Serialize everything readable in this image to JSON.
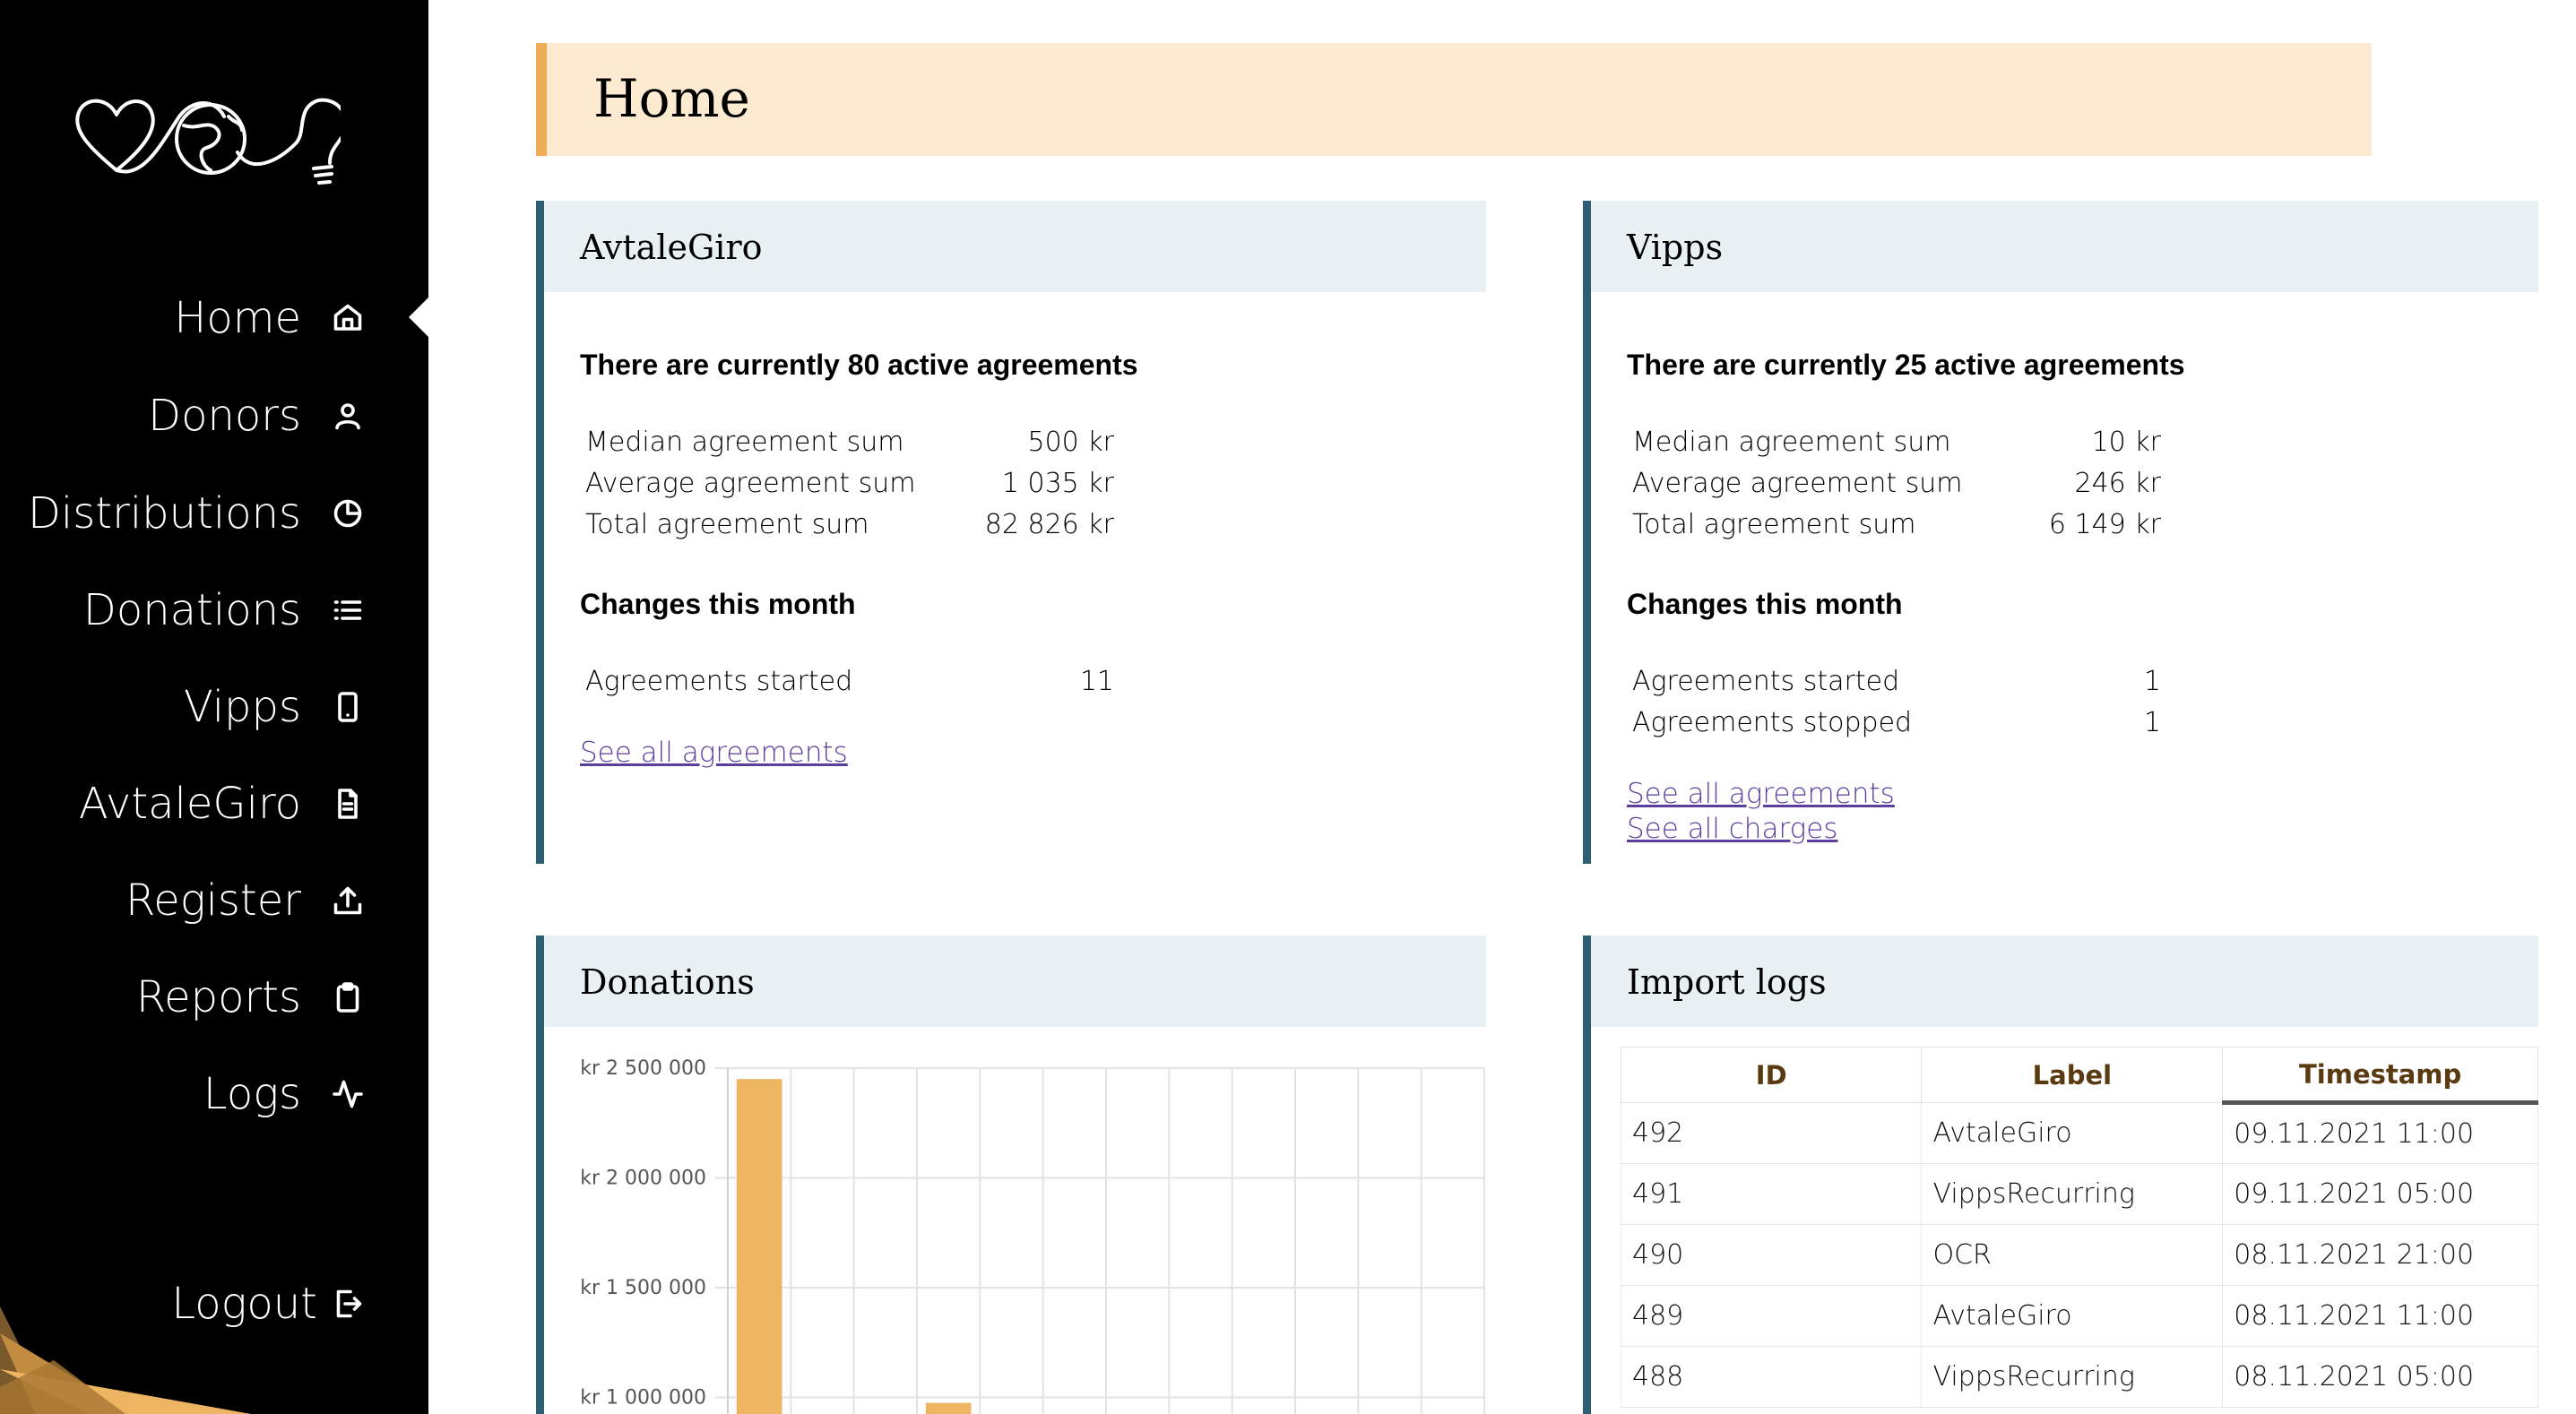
{
  "sidebar": {
    "logo_icon": "heart-globe-lightbulb-logo",
    "items": [
      {
        "label": "Home",
        "icon": "home-icon"
      },
      {
        "label": "Donors",
        "icon": "user-icon"
      },
      {
        "label": "Distributions",
        "icon": "pie-chart-icon"
      },
      {
        "label": "Donations",
        "icon": "list-icon"
      },
      {
        "label": "Vipps",
        "icon": "smartphone-icon"
      },
      {
        "label": "AvtaleGiro",
        "icon": "file-text-icon"
      },
      {
        "label": "Register",
        "icon": "upload-icon"
      },
      {
        "label": "Reports",
        "icon": "clipboard-icon"
      },
      {
        "label": "Logs",
        "icon": "activity-icon"
      }
    ],
    "active": "Home",
    "logout": {
      "label": "Logout",
      "icon": "logout-icon"
    }
  },
  "header": {
    "title": "Home"
  },
  "avtalegiro": {
    "title": "AvtaleGiro",
    "summary": "There are currently 80 active agreements",
    "stats": [
      {
        "label": "Median agreement sum",
        "value": "500 kr"
      },
      {
        "label": "Average agreement sum",
        "value": "1 035 kr"
      },
      {
        "label": "Total agreement sum",
        "value": "82 826 kr"
      }
    ],
    "changes_title": "Changes this month",
    "changes": [
      {
        "label": "Agreements started",
        "value": "11"
      }
    ],
    "link_agreements": "See all agreements"
  },
  "vipps": {
    "title": "Vipps",
    "summary": "There are currently 25 active agreements",
    "stats": [
      {
        "label": "Median agreement sum",
        "value": "10 kr"
      },
      {
        "label": "Average agreement sum",
        "value": "246 kr"
      },
      {
        "label": "Total agreement sum",
        "value": "6 149 kr"
      }
    ],
    "changes_title": "Changes this month",
    "changes": [
      {
        "label": "Agreements started",
        "value": "1"
      },
      {
        "label": "Agreements stopped",
        "value": "1"
      }
    ],
    "link_agreements": "See all agreements",
    "link_charges": "See all charges"
  },
  "donations": {
    "title": "Donations"
  },
  "chart_data": {
    "type": "bar",
    "title": "",
    "xlabel": "",
    "ylabel": "",
    "yticks": [
      "kr 2 500 000",
      "kr 2 000 000",
      "kr 1 500 000",
      "kr 1 000 000"
    ],
    "ylim_visible": [
      1000000,
      2500000
    ],
    "values": [
      2450000,
      0,
      0,
      975000,
      0,
      0,
      0,
      0,
      0,
      0,
      0,
      0
    ],
    "bar_color": "#edb561",
    "grid": true
  },
  "import_logs": {
    "title": "Import logs",
    "columns": [
      "ID",
      "Label",
      "Timestamp"
    ],
    "sorted_column": "Timestamp",
    "rows": [
      {
        "id": "492",
        "label": "AvtaleGiro",
        "timestamp": "09.11.2021 11:00"
      },
      {
        "id": "491",
        "label": "VippsRecurring",
        "timestamp": "09.11.2021 05:00"
      },
      {
        "id": "490",
        "label": "OCR",
        "timestamp": "08.11.2021 21:00"
      },
      {
        "id": "489",
        "label": "AvtaleGiro",
        "timestamp": "08.11.2021 11:00"
      },
      {
        "id": "488",
        "label": "VippsRecurring",
        "timestamp": "08.11.2021 05:00"
      }
    ]
  },
  "colors": {
    "sidebar_bg": "#000000",
    "header_bg": "#fcebd0",
    "header_accent": "#f0ad55",
    "card_head_bg": "#e8f0f3",
    "card_accent": "#2d5f73",
    "link": "#5b3f9a"
  }
}
